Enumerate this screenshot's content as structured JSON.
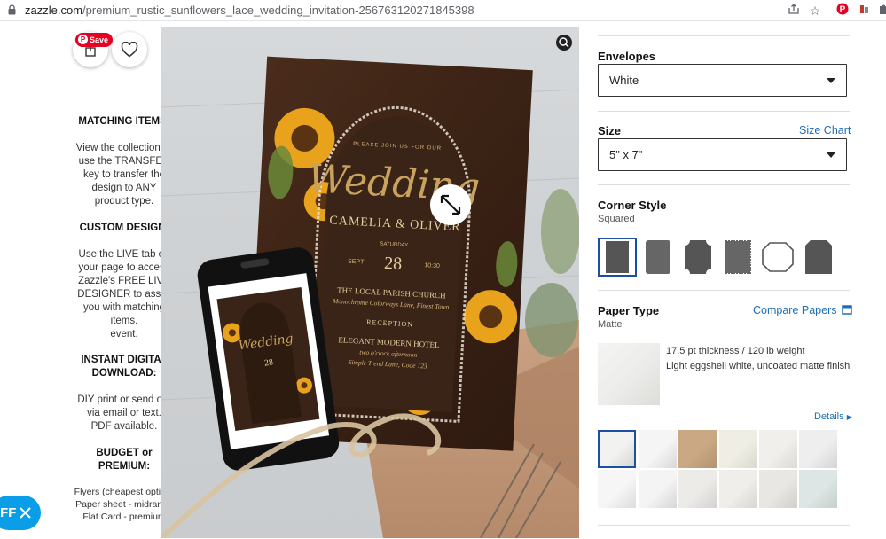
{
  "browser": {
    "url_domain": "zazzle.com",
    "url_path": "/premium_rustic_sunflowers_lace_wedding_invitation-256763120271845398"
  },
  "left": {
    "save_label": "Save",
    "sections": [
      {
        "heading": "MATCHING ITEMS:",
        "body": [
          "View the collection or",
          "use the TRANSFER",
          "key to transfer the",
          "design to ANY",
          "product type."
        ]
      },
      {
        "heading": "CUSTOM DESIGN:",
        "body": [
          "Use the LIVE tab on",
          "your page to access",
          "Zazzle's FREE LIVE",
          "DESIGNER to assist",
          "you with matching",
          "items.",
          "event."
        ]
      },
      {
        "heading": "INSTANT DIGITAL DOWNLOAD:",
        "heading_lines": [
          "INSTANT DIGITAL",
          "DOWNLOAD:"
        ],
        "body": [
          "DIY print or send out",
          "via email or text.",
          "PDF available."
        ]
      },
      {
        "heading": "BUDGET or PREMIUM:",
        "heading_lines": [
          "BUDGET or",
          "PREMIUM:"
        ],
        "body": [
          "Flyers (cheapest option)",
          "Paper sheet - midrange",
          "Flat Card - premium"
        ]
      }
    ],
    "chat_label": "FF"
  },
  "invitation": {
    "intro": "PLEASE JOIN US FOR OUR",
    "script_title": "Wedding",
    "names": "CAMELIA & OLIVER",
    "day": "SATURDAY",
    "month": "SEPT",
    "date": "28",
    "time": "10:30",
    "venue": "THE LOCAL PARISH CHURCH",
    "venue_address": "Monochrome Colorways Lane, Finest Town",
    "reception": "RECEPTION",
    "hotel": "ELEGANT MODERN HOTEL",
    "hotel_time": "two o'clock afternoon",
    "hotel_address": "Simple Trend Lane, Code 123"
  },
  "options": {
    "envelopes": {
      "label": "Envelopes",
      "value": "White"
    },
    "size": {
      "label": "Size",
      "link": "Size Chart",
      "value": "5\" x 7\""
    },
    "corner": {
      "label": "Corner Style",
      "selected": "Squared"
    },
    "paper": {
      "label": "Paper Type",
      "link": "Compare Papers",
      "selected": "Matte",
      "thickness": "17.5 pt thickness / 120 lb weight",
      "finish": "Light eggshell white, uncoated matte finish",
      "details": "Details"
    }
  },
  "colors": {
    "accent_link": "#1e6db6",
    "selection": "#1e4fa3",
    "pinterest": "#e60023",
    "chat": "#0a9ee8",
    "card_brown": "#3a2417",
    "gold": "#d9b77a"
  }
}
